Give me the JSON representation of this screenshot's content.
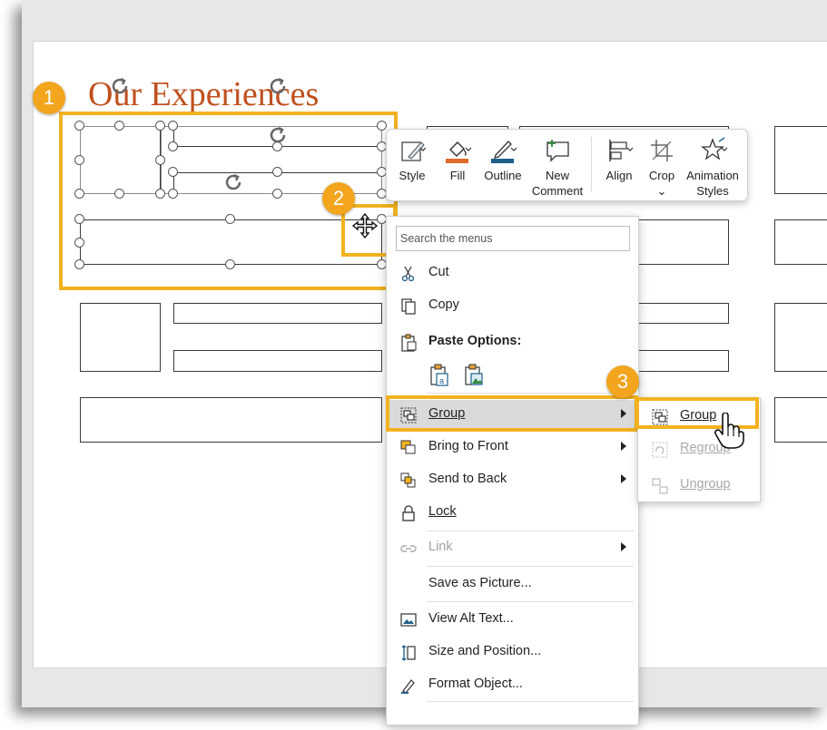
{
  "slide": {
    "title": "Our Experiences"
  },
  "callouts": [
    "1",
    "2",
    "3"
  ],
  "mini_toolbar": {
    "buttons": [
      {
        "id": "style",
        "label": "Style"
      },
      {
        "id": "fill",
        "label": "Fill"
      },
      {
        "id": "outline",
        "label": "Outline"
      },
      {
        "id": "new_comment",
        "label_line1": "New",
        "label_line2": "Comment"
      },
      {
        "id": "align",
        "label": "Align"
      },
      {
        "id": "crop",
        "label": "Crop"
      },
      {
        "id": "animation",
        "label_line1": "Animation",
        "label_line2": "Styles"
      }
    ]
  },
  "context_menu": {
    "search_placeholder": "Search the menus",
    "items": [
      {
        "id": "cut",
        "label": "Cut",
        "icon": "scissors-icon"
      },
      {
        "id": "copy",
        "label": "Copy",
        "icon": "copy-icon"
      },
      {
        "id": "paste_options",
        "label": "Paste Options:",
        "icon": "clipboard-icon"
      },
      {
        "id": "group",
        "label": "Group",
        "icon": "group-icon",
        "submenu": true,
        "highlighted": true
      },
      {
        "id": "bring_front",
        "label": "Bring to Front",
        "icon": "bring-front-icon",
        "submenu": true
      },
      {
        "id": "send_back",
        "label": "Send to Back",
        "icon": "send-back-icon",
        "submenu": true
      },
      {
        "id": "lock",
        "label": "Lock",
        "icon": "lock-icon"
      },
      {
        "id": "link",
        "label": "Link",
        "icon": "link-icon",
        "submenu": true,
        "disabled": true
      },
      {
        "id": "save_picture",
        "label": "Save as Picture..."
      },
      {
        "id": "alt_text",
        "label": "View Alt Text...",
        "icon": "alt-text-icon"
      },
      {
        "id": "size_position",
        "label": "Size and Position...",
        "icon": "size-position-icon"
      },
      {
        "id": "format_object",
        "label": "Format Object...",
        "icon": "format-object-icon"
      }
    ]
  },
  "group_submenu": {
    "items": [
      {
        "id": "group",
        "label": "Group",
        "icon": "group-icon",
        "highlighted": true
      },
      {
        "id": "regroup",
        "label": "Regroup",
        "icon": "regroup-icon",
        "disabled": true
      },
      {
        "id": "ungroup",
        "label": "Ungroup",
        "icon": "ungroup-icon",
        "disabled": true
      }
    ]
  },
  "colors": {
    "accent": "#f2b21f",
    "title": "#c0501f",
    "fill": "#e06a2b",
    "outline": "#1f5f8b"
  }
}
